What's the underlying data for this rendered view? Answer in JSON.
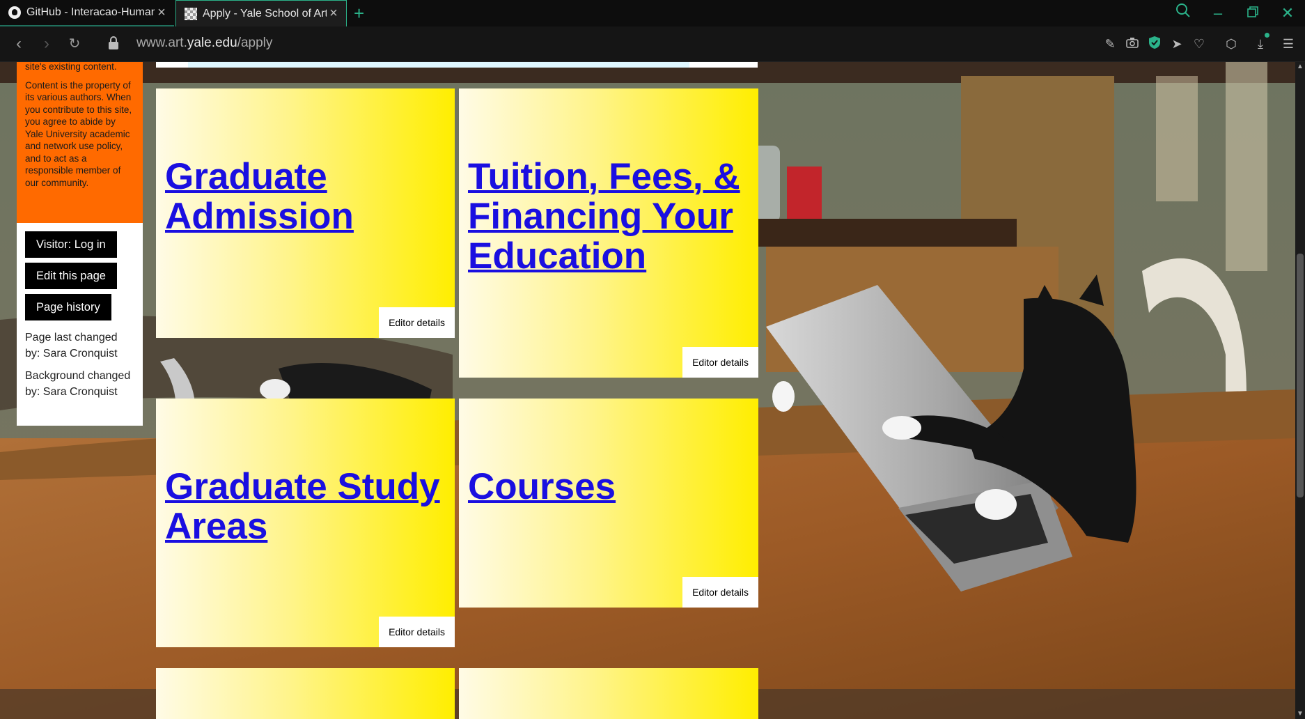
{
  "tabs": [
    {
      "title": "GitHub - Interacao-Human",
      "favicon": "github-icon"
    },
    {
      "title": "Apply - Yale School of Art",
      "favicon": "checkerboard-icon"
    }
  ],
  "address": {
    "url_prefix": "www.art.",
    "url_host": "yale.edu",
    "url_path": "/apply"
  },
  "sidebar": {
    "notice_top": "site's existing content.",
    "notice_body": "Content is the property of its various authors. When you contribute to this site, you agree to abide by Yale University academic and network use policy, and to act as a responsible member of our community.",
    "buttons": {
      "login": "Visitor: Log in",
      "edit": "Edit this page",
      "history": "Page history"
    },
    "page_changed_label": "Page last changed",
    "page_changed_by": "by: Sara Cronquist",
    "bg_changed_label": "Background changed",
    "bg_changed_by": "by: Sara Cronquist"
  },
  "cards": [
    {
      "title": "Graduate Admission",
      "editor": "Editor details"
    },
    {
      "title": "Tuition, Fees, & Financing Your Education",
      "editor": "Editor details"
    },
    {
      "title": "Graduate Study Areas",
      "editor": "Editor details"
    },
    {
      "title": "Courses",
      "editor": "Editor details"
    }
  ],
  "colors": {
    "accent": "#2bb38a",
    "orange": "#ff6a00",
    "link": "#1a0fe0",
    "card_yellow": "#ffee00"
  }
}
